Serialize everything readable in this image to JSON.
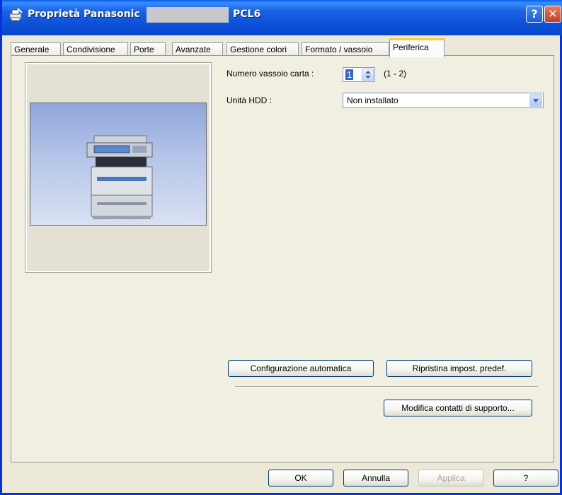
{
  "window": {
    "title_prefix": "Proprietà Panasonic",
    "title_suffix": "PCL6",
    "help_glyph": "?",
    "close_glyph": "✕"
  },
  "tabs": [
    {
      "label": "Generale",
      "active": false
    },
    {
      "label": "Condivisione",
      "active": false
    },
    {
      "label": "Porte",
      "active": false
    },
    {
      "label": "Avanzate",
      "active": false
    },
    {
      "label": "Gestione colori",
      "active": false
    },
    {
      "label": "Formato / vassoio",
      "active": false
    },
    {
      "label": "Periferica",
      "active": true
    }
  ],
  "device": {
    "tray_count_label": "Numero vassoio carta :",
    "tray_count_value": "1",
    "tray_count_range": "(1 - 2)",
    "hdd_label": "Unità HDD :",
    "hdd_value": "Non installato"
  },
  "buttons": {
    "auto_config": "Configurazione automatica",
    "restore_defaults": "Ripristina impost. predef.",
    "edit_support_contacts": "Modifica contatti di supporto...",
    "ok": "OK",
    "cancel": "Annulla",
    "apply": "Applica",
    "help": "?"
  },
  "colors": {
    "title_bar": "#0b50d8",
    "active_tab_accent": "#ffc83c",
    "dialog_bg": "#ece9d8"
  },
  "icons": [
    "printer-icon",
    "help-icon",
    "close-icon",
    "spin-up-icon",
    "spin-down-icon",
    "dropdown-arrow-icon"
  ]
}
